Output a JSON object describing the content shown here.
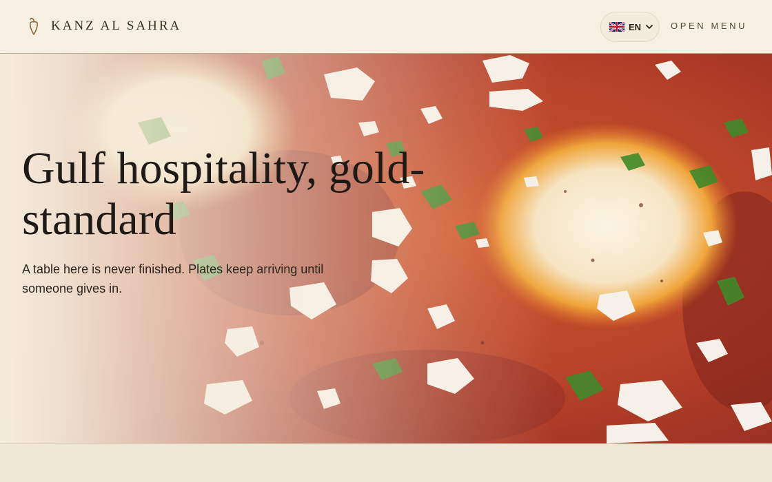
{
  "header": {
    "brand_name": "KANZ AL SAHRA",
    "brand_icon": "pepper-icon",
    "language": {
      "code": "EN",
      "flag_icon": "uk-flag-icon",
      "dropdown_icon": "chevron-down-icon"
    },
    "menu_label": "OPEN MENU"
  },
  "hero": {
    "title": "Gulf hospitality, gold-standard",
    "subtitle": "A table here is never finished. Plates keep arriving until someone gives in.",
    "image": "shakshuka-photo"
  },
  "colors": {
    "header_bg": "#f6efe2",
    "page_bg": "#efe6d5",
    "text_dark": "#1f1a16",
    "sauce_red": "#b94a2b"
  }
}
